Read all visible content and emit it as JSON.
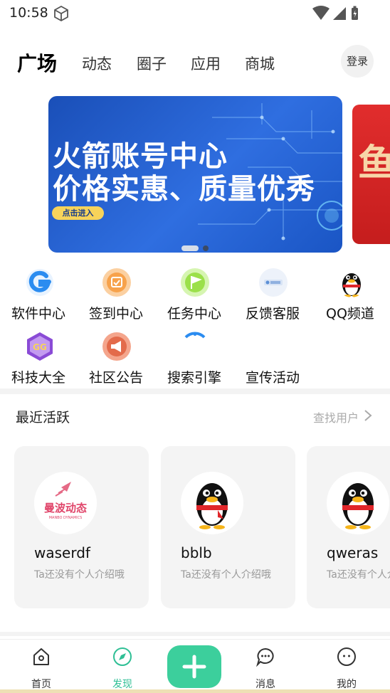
{
  "status_bar": {
    "time": "10:58"
  },
  "top_nav": {
    "tabs": [
      {
        "label": "广场",
        "active": true
      },
      {
        "label": "动态",
        "active": false
      },
      {
        "label": "圈子",
        "active": false
      },
      {
        "label": "应用",
        "active": false
      },
      {
        "label": "商城",
        "active": false
      }
    ],
    "login_label": "登录"
  },
  "banner": {
    "line1": "火箭账号中心",
    "line2": "价格实惠、质量优秀",
    "cta_label": "点击进入",
    "next_preview_glyph": "鱼"
  },
  "shortcuts": [
    {
      "label": "软件中心",
      "icon": "software-center-icon",
      "color": "#2b8cf0"
    },
    {
      "label": "签到中心",
      "icon": "checkin-icon",
      "color": "#f7a24b"
    },
    {
      "label": "任务中心",
      "icon": "task-flag-icon",
      "color": "#9be04a"
    },
    {
      "label": "反馈客服",
      "icon": "feedback-icon",
      "color": "#e9eef7"
    },
    {
      "label": "QQ频道",
      "icon": "qq-penguin-icon",
      "color": "#ffffff"
    },
    {
      "label": "科技大全",
      "icon": "gg-tech-icon",
      "color": "#7b3fc8"
    },
    {
      "label": "社区公告",
      "icon": "megaphone-icon",
      "color": "#e36b4b"
    },
    {
      "label": "搜索引擎",
      "icon": "search-engine-icon",
      "color": "#2b8cf0"
    },
    {
      "label": "宣传活动",
      "icon": "promo-icon",
      "color": "#ffffff"
    }
  ],
  "recent": {
    "title": "最近活跃",
    "find_user_label": "查找用户",
    "users": [
      {
        "name": "waserdf",
        "bio": "Ta还没有个人介绍哦",
        "avatar_text": "曼波动态",
        "avatar_subtext": "MANBO DYNAMICS"
      },
      {
        "name": "bblb",
        "bio": "Ta还没有个人介绍哦"
      },
      {
        "name": "qweras",
        "bio": "Ta还没有个人介绍哦"
      }
    ]
  },
  "bottom_nav": {
    "items": [
      {
        "label": "首页",
        "icon": "home-icon",
        "active": false
      },
      {
        "label": "发现",
        "icon": "compass-icon",
        "active": true
      },
      {
        "label": "消息",
        "icon": "message-icon",
        "active": false
      },
      {
        "label": "我的",
        "icon": "profile-icon",
        "active": false
      }
    ]
  },
  "colors": {
    "accent": "#3ccf9c",
    "banner_blue": "#2f6ee0",
    "banner_red": "#d8262a"
  }
}
